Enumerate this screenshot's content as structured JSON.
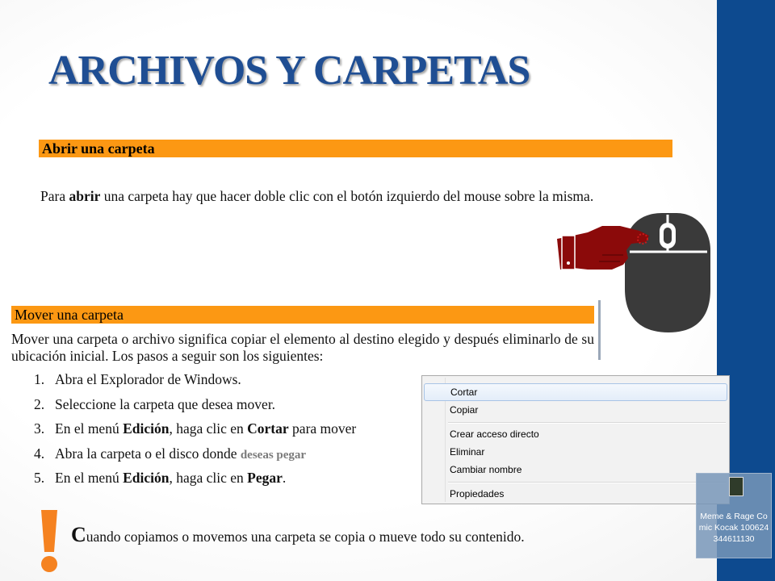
{
  "slide": {
    "title": "ARCHIVOS Y CARPETAS"
  },
  "section_open": {
    "heading": "Abrir una carpeta",
    "text_before": "Para ",
    "text_bold": "abrir",
    "text_after": " una carpeta hay que hacer doble clic con el botón izquierdo del mouse sobre la misma."
  },
  "section_move": {
    "heading": "Mover una carpeta",
    "intro": "Mover una carpeta o archivo significa copiar el elemento al destino elegido y después eliminarlo de su ubicación inicial. Los pasos a seguir son los siguientes:",
    "steps": [
      {
        "num": "1.",
        "parts": [
          {
            "t": "Abra el Explorador de Windows."
          }
        ]
      },
      {
        "num": "2.",
        "parts": [
          {
            "t": "Seleccione la carpeta que desea mover."
          }
        ]
      },
      {
        "num": "3.",
        "parts": [
          {
            "t": "En el menú "
          },
          {
            "t": "Edición",
            "b": true
          },
          {
            "t": ", haga clic en "
          },
          {
            "t": "Cortar",
            "b": true
          },
          {
            "t": " para mover"
          }
        ]
      },
      {
        "num": "4.",
        "parts": [
          {
            "t": "Abra la carpeta o el disco donde "
          }
        ],
        "tail": "deseas pegar"
      },
      {
        "num": "5.",
        "parts": [
          {
            "t": "En el menú "
          },
          {
            "t": "Edición",
            "b": true
          },
          {
            "t": ", haga clic en "
          },
          {
            "t": "Pegar",
            "b": true
          },
          {
            "t": "."
          }
        ]
      }
    ]
  },
  "note": {
    "dropcap": "C",
    "text": "uando copiamos o movemos una carpeta se copia o mueve todo su contenido."
  },
  "context_menu": {
    "items": [
      {
        "label": "Cortar",
        "highlighted": true
      },
      {
        "label": "Copiar"
      },
      {
        "label": "Crear acceso directo"
      },
      {
        "label": "Eliminar"
      },
      {
        "label": "Cambiar nombre"
      },
      {
        "label": "Propiedades"
      }
    ]
  },
  "desktop_icon": {
    "label": "Meme & Rage Comic Kocak 100624344611130"
  },
  "icons": [
    "pointing-hand-icon",
    "computer-mouse-icon",
    "exclamation-icon",
    "image-file-icon"
  ],
  "colors": {
    "title": "#1f4e93",
    "band": "#fc9813",
    "side_bar": "#0d4a8f",
    "hand": "#8b0a0a",
    "mouse": "#3a3a3a",
    "exclamation": "#f58220"
  }
}
